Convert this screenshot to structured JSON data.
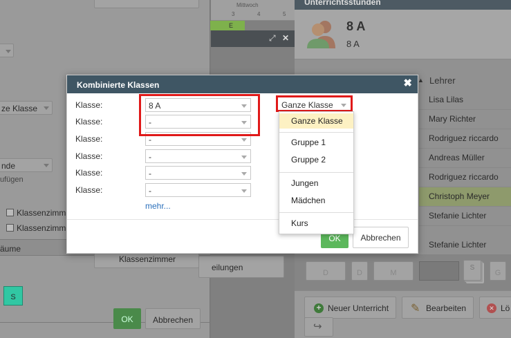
{
  "background": {
    "left_panel": {
      "select_1_value": "ze Klasse",
      "select_2_value": "nde",
      "hint_text": "ufügen",
      "checkbox_1_label": "Klassenzimm",
      "checkbox_2_label": "Klassenzimm",
      "section_label": "äume",
      "btn_classroom": "Klassenzimmer",
      "s_button": "S",
      "ok_label": "OK",
      "cancel_label": "Abbrechen"
    },
    "middle_panel": {
      "day_label": "Mittwoch",
      "period_numbers": [
        "3",
        "4",
        "5"
      ],
      "cell_letter": "E",
      "button_text": "eilungen"
    },
    "right_panel": {
      "header_title": "Unterrichtsstunden",
      "class_title": "8 A",
      "class_subtitle": "8 A",
      "column_header": "Lehrer",
      "teachers": [
        "Lisa Lilas",
        "Mary Richter",
        "Rodriguez riccardo",
        "Andreas Müller",
        "Rodriguez riccardo",
        "Christoph Meyer",
        "Stefanie Lichter",
        "Stefanie Lichter"
      ],
      "day_tiles": [
        "D",
        "D",
        "M",
        "",
        "S",
        "G"
      ],
      "new_lesson_label": "Neuer Unterricht",
      "edit_label": "Bearbeiten",
      "delete_label": "Lö"
    }
  },
  "dialog": {
    "title": "Kombinierte Klassen",
    "close_symbol": "✖",
    "row_label": "Klasse:",
    "rows": [
      {
        "label": "Klasse:",
        "value": "8 A"
      },
      {
        "label": "Klasse:",
        "value": "-"
      },
      {
        "label": "Klasse:",
        "value": "-"
      },
      {
        "label": "Klasse:",
        "value": "-"
      },
      {
        "label": "Klasse:",
        "value": "-"
      },
      {
        "label": "Klasse:",
        "value": "-"
      }
    ],
    "more_link": "mehr...",
    "group_select_value": "Ganze Klasse",
    "ok_label": "OK",
    "cancel_label": "Abbrechen",
    "dropdown_options": [
      "Ganze Klasse",
      "Gruppe 1",
      "Gruppe 2",
      "Jungen",
      "Mädchen",
      "Kurs"
    ],
    "selected_option": "Ganze Klasse"
  },
  "colors": {
    "dialog_header": "#3f5664",
    "highlight_red": "#e01919",
    "ok_green": "#5cb85c",
    "selected_option_bg": "#fdf1c3",
    "link_blue": "#2a6fbb"
  }
}
